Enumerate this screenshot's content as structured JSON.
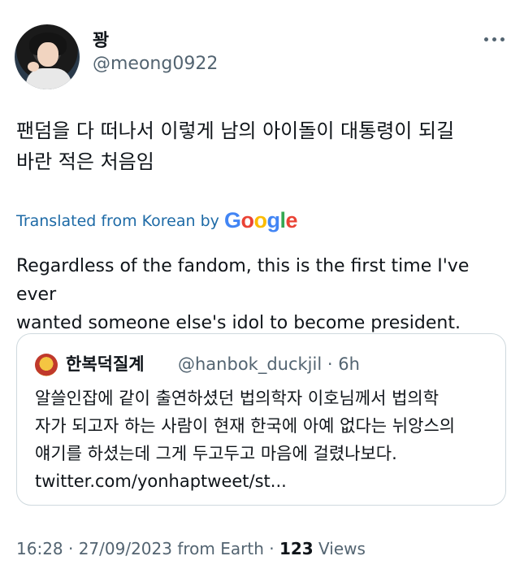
{
  "tweet": {
    "author": {
      "display_name": "꽝",
      "handle": "@meong0922"
    },
    "text_korean_lines": [
      "팬덤을 다 떠나서 이렇게 남의 아이돌이 대통령이 되길",
      "바란 적은 처음임"
    ],
    "translation": {
      "label": "Translated from Korean by",
      "provider": "Google",
      "text_lines": [
        "Regardless of the fandom, this is the first time I've ever",
        "wanted someone else's idol to become president."
      ]
    },
    "quoted_tweet": {
      "display_name": "한복덕질계",
      "handle_time": "@hanbok_duckjil · 6h",
      "text_lines": [
        "알쓸인잡에 같이 출연하셨던 법의학자 이호님께서 법의학",
        "자가 되고자 하는 사람이 현재 한국에 아예 없다는 뉘앙스의",
        "얘기를 하셨는데 그게 두고두고 마음에 걸렸나보다.",
        "twitter.com/yonhaptweet/st..."
      ]
    },
    "footer": {
      "meta": "16:28 · 27/09/2023 from Earth · ",
      "views_count": "123",
      "views_label": " Views"
    }
  },
  "icons": {
    "more": "more-horizontal-icon"
  },
  "colors": {
    "text": "#0f1419",
    "secondary": "#536471",
    "translate_link": "#1d6aa6",
    "border": "#cfd9de"
  }
}
